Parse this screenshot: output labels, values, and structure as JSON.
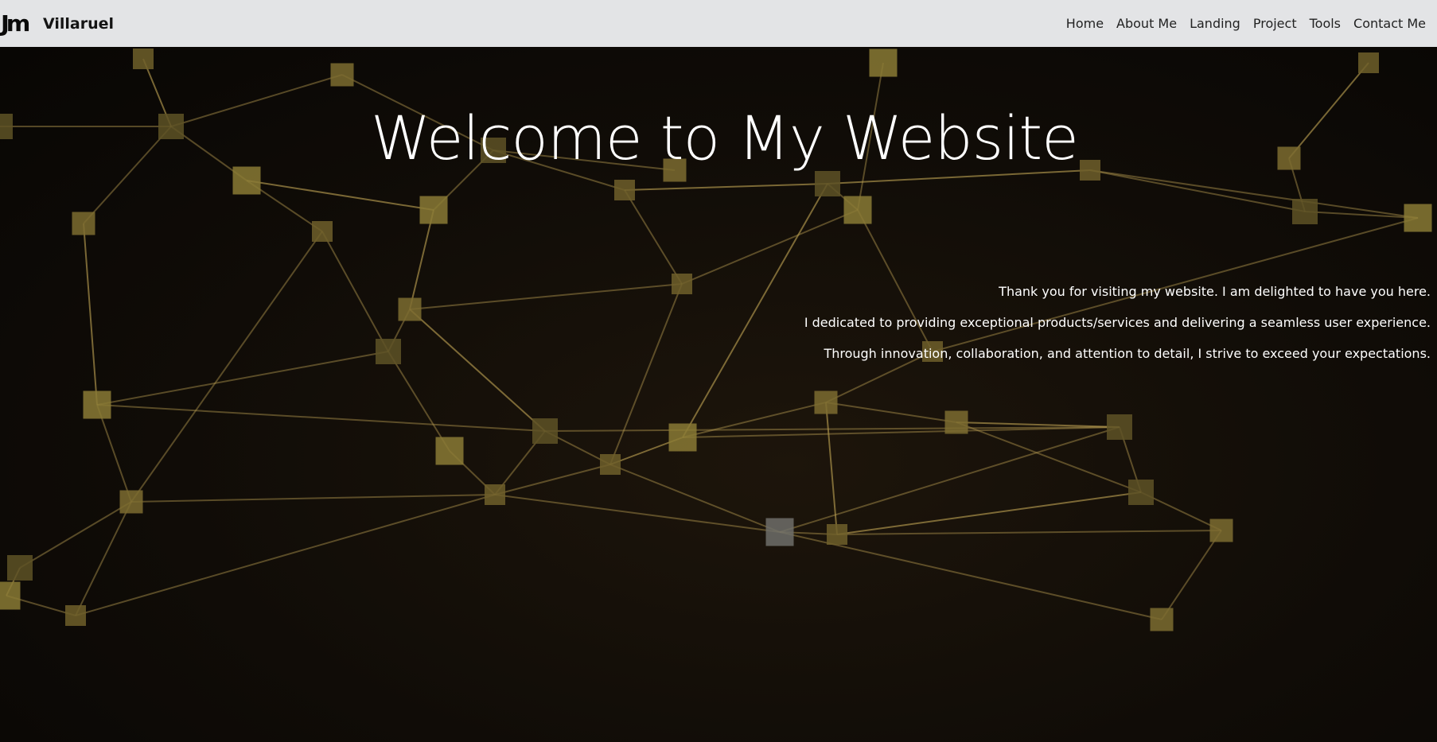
{
  "header": {
    "logo_text": "Jm",
    "brand_name": "Villaruel",
    "nav": [
      {
        "label": "Home"
      },
      {
        "label": "About Me"
      },
      {
        "label": "Landing"
      },
      {
        "label": "Project"
      },
      {
        "label": "Tools"
      },
      {
        "label": "Contact Me"
      }
    ]
  },
  "hero": {
    "title": "Welcome to My Website",
    "paragraphs": [
      "Thank you for visiting my website. I am delighted to have you here.",
      "I dedicated to providing exceptional products/services and delivering a seamless user experience.",
      "Through innovation, collaboration, and attention to detail, I strive to exceed your expectations."
    ],
    "background": "network-graph-image"
  },
  "colors": {
    "nav_bg": "#e3e4e6",
    "hero_bg": "#100c07",
    "network_line": "#b39a4f",
    "network_node": "#8a7a35",
    "text": "#ffffff"
  }
}
